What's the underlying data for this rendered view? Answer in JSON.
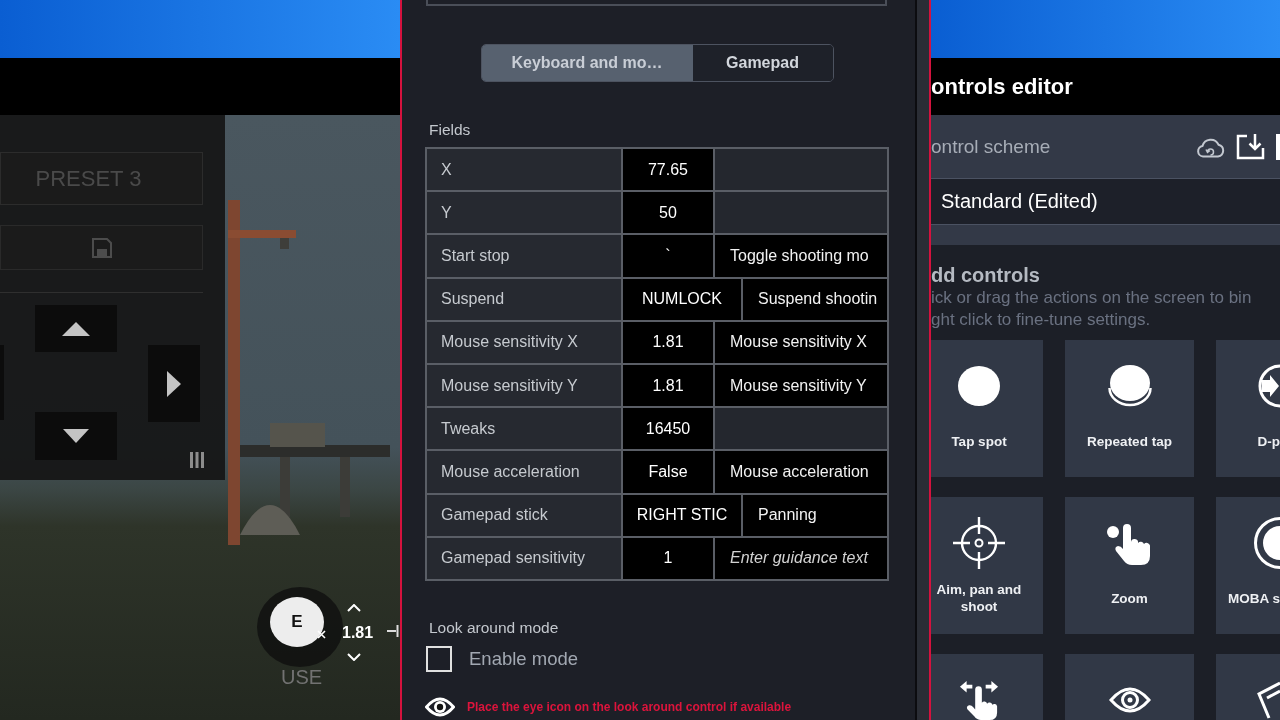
{
  "game_view": {
    "preset_label": "PRESET 3",
    "key_control": {
      "key": "E",
      "sensitivity": "1.81",
      "caption": "USE"
    }
  },
  "properties_panel": {
    "tabs": [
      {
        "label": "Keyboard and mo…",
        "selected": true
      },
      {
        "label": "Gamepad",
        "selected": false
      }
    ],
    "fields_heading": "Fields",
    "fields": [
      {
        "label": "X",
        "value": "77.65",
        "kind": "input"
      },
      {
        "label": "Y",
        "value": "50",
        "kind": "input"
      },
      {
        "label": "Start stop",
        "value": "`",
        "kind": "input",
        "description": "Toggle shooting mo"
      },
      {
        "label": "Suspend",
        "value": "NUMLOCK",
        "kind": "combo",
        "description": "Suspend shootin"
      },
      {
        "label": "Mouse sensitivity X",
        "value": "1.81",
        "kind": "input",
        "description": "Mouse sensitivity X"
      },
      {
        "label": "Mouse sensitivity Y",
        "value": "1.81",
        "kind": "input",
        "description": "Mouse sensitivity Y"
      },
      {
        "label": "Tweaks",
        "value": "16450",
        "kind": "input"
      },
      {
        "label": "Mouse acceleration",
        "value": "False",
        "kind": "input",
        "description": "Mouse acceleration"
      },
      {
        "label": "Gamepad stick",
        "value": "RIGHT STIC",
        "kind": "combo",
        "description": "Panning"
      },
      {
        "label": "Gamepad sensitivity",
        "value": "1",
        "kind": "input",
        "placeholder": "Enter guidance text"
      }
    ],
    "look_around": {
      "heading": "Look around mode",
      "checkbox": {
        "label": "Enable mode",
        "checked": false
      },
      "hint": "Place the eye icon on the look around control if available"
    }
  },
  "controls_editor": {
    "title": "ontrols editor",
    "scheme": {
      "label": "ontrol scheme",
      "value": "Standard (Edited)"
    },
    "add_controls": {
      "heading": "dd controls",
      "description": [
        "ick or drag the actions on the screen to bin",
        "ght click to fine-tune settings."
      ]
    },
    "tiles": [
      {
        "kind": "tap",
        "label": "Tap spot"
      },
      {
        "kind": "repeat",
        "label": "Repeated tap"
      },
      {
        "kind": "dpad",
        "label": "D-p"
      },
      {
        "kind": "aim",
        "label": "Aim, pan and shoot"
      },
      {
        "kind": "zoom",
        "label": "Zoom"
      },
      {
        "kind": "moba",
        "label": "MOBA s"
      },
      {
        "kind": "swipe"
      },
      {
        "kind": "view"
      },
      {
        "kind": "tilt"
      }
    ]
  }
}
